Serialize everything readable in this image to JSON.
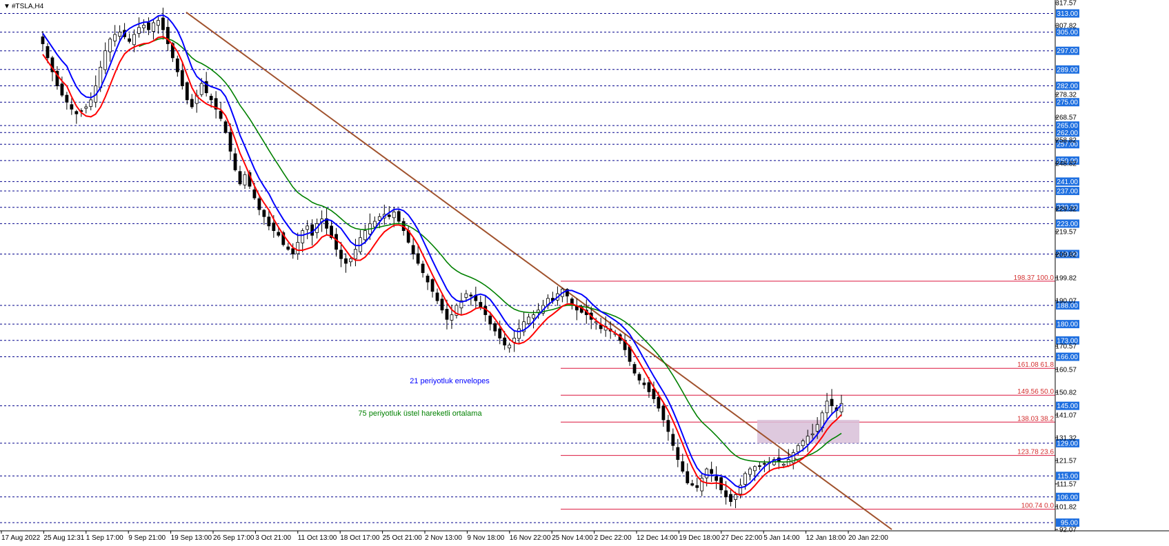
{
  "chart_title": "#TSLA,H4",
  "menu_glyph": "▼",
  "colors": {
    "background": "#ffffff",
    "candles": "#000000",
    "envelope_upper": "#0000ff",
    "envelope_lower": "#ff0000",
    "ema75": "#008000",
    "trendline": "#a0522d",
    "fib_lines": "#dc143c",
    "level_lines": "#00008b",
    "level_tag_bg": "#1e6fe0",
    "zone_fill": "#d8bfd8"
  },
  "annotations": {
    "envelopes": "21 periyotluk envelopes",
    "ema": "75 periyotluk üstel hareketli ortalama"
  },
  "chart_data": {
    "type": "candlestick",
    "symbol": "#TSLA",
    "timeframe": "H4",
    "ylim": [
      92.07,
      317.57
    ],
    "y_scale_labels": [
      "317.57",
      "307.82",
      "278.32",
      "268.57",
      "258.82",
      "248.82",
      "229.32",
      "219.57",
      "209.82",
      "199.82",
      "190.07",
      "170.57",
      "160.57",
      "150.82",
      "141.07",
      "131.32",
      "121.57",
      "111.57",
      "101.82",
      "92.07"
    ],
    "x_tick_labels": [
      "17 Aug 2022",
      "25 Aug 12:31",
      "1 Sep 17:00",
      "9 Sep 21:00",
      "19 Sep 13:00",
      "26 Sep 17:00",
      "3 Oct 21:00",
      "11 Oct 13:00",
      "18 Oct 17:00",
      "25 Oct 21:00",
      "2 Nov 13:00",
      "9 Nov 18:00",
      "16 Nov 22:00",
      "25 Nov 14:00",
      "2 Dec 22:00",
      "12 Dec 14:00",
      "19 Dec 18:00",
      "27 Dec 22:00",
      "5 Jan 14:00",
      "12 Jan 18:00",
      "20 Jan 22:00"
    ],
    "horizontal_levels": [
      313.0,
      305.0,
      297.0,
      289.0,
      282.0,
      275.0,
      265.0,
      262.0,
      257.0,
      250.0,
      241.0,
      237.0,
      230.0,
      223.0,
      210.0,
      188.0,
      180.0,
      173.0,
      166.0,
      145.0,
      129.0,
      115.0,
      106.0,
      95.0
    ],
    "fibonacci": [
      {
        "price": 198.37,
        "label": "198.37 100.0"
      },
      {
        "price": 161.08,
        "label": "161.08 61.8"
      },
      {
        "price": 149.56,
        "label": "149.56 50.0"
      },
      {
        "price": 138.03,
        "label": "138.03 38.2"
      },
      {
        "price": 123.78,
        "label": "123.78 23.6"
      },
      {
        "price": 100.74,
        "label": "100.74 0.0"
      }
    ],
    "trendline": [
      {
        "bar": 0.19,
        "price": 313.0
      },
      {
        "bar": 1.0,
        "price": 92.07
      }
    ],
    "zone": {
      "bar_from": 0.79,
      "bar_to": 0.893,
      "price_from": 129.0,
      "price_to": 139.0
    },
    "closes": [
      300,
      294,
      288,
      282,
      278,
      275,
      272,
      270,
      271,
      273,
      276,
      282,
      290,
      297,
      302,
      304,
      305,
      303,
      301,
      304,
      307,
      308,
      306,
      309,
      310,
      306,
      300,
      294,
      288,
      282,
      276,
      273,
      278,
      283,
      279,
      276,
      272,
      268,
      262,
      254,
      246,
      240,
      244,
      239,
      234,
      229,
      226,
      222,
      220,
      218,
      214,
      212,
      210,
      215,
      220,
      222,
      218,
      223,
      225,
      221,
      217,
      212,
      208,
      206,
      208,
      212,
      217,
      220,
      223,
      224,
      226,
      227,
      226,
      228,
      224,
      220,
      215,
      210,
      206,
      202,
      198,
      194,
      190,
      186,
      182,
      184,
      188,
      190,
      193,
      192,
      190,
      187,
      184,
      180,
      177,
      174,
      171,
      171,
      174,
      178,
      181,
      183,
      184,
      186,
      188,
      191,
      190,
      193,
      195,
      192,
      188,
      186,
      185,
      184,
      182,
      181,
      178,
      179,
      177,
      176,
      173,
      169,
      164,
      159,
      156,
      154,
      151,
      148,
      144,
      139,
      134,
      128,
      122,
      117,
      112,
      111,
      110,
      114,
      118,
      116,
      113,
      109,
      106,
      104,
      107,
      111,
      116,
      118,
      119,
      119,
      120,
      121,
      122,
      121,
      120,
      122,
      125,
      128,
      130,
      132,
      133,
      137,
      142,
      147,
      145,
      143,
      146
    ]
  }
}
